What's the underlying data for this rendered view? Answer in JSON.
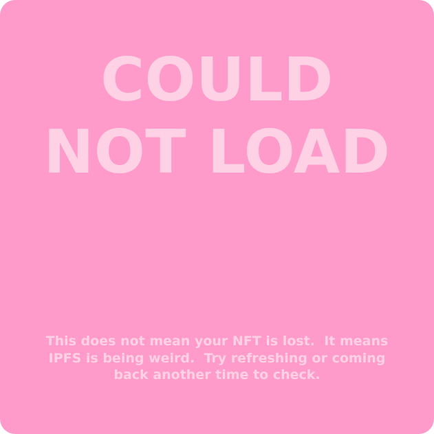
{
  "error": {
    "headline_line1": "COULD",
    "headline_line2": "NOT LOAD",
    "message_line1": "This does not mean your NFT is lost.  It means",
    "message_line2": "IPFS is being weird.  Try refreshing or coming",
    "message_line3": "back another time to check."
  },
  "colors": {
    "background": "#ff9bcb",
    "text": "#ffd1e5"
  }
}
